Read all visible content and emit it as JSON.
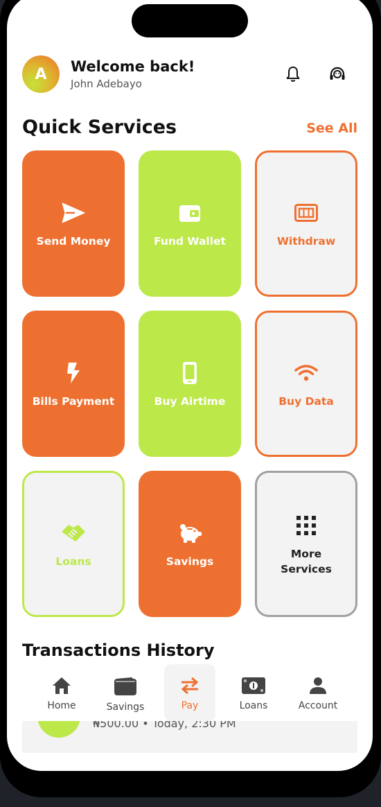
{
  "header": {
    "avatar_initial": "A",
    "welcome": "Welcome back!",
    "user_name": "John Adebayo",
    "icons": [
      "bell-icon",
      "headset-icon"
    ]
  },
  "quick_services": {
    "title": "Quick Services",
    "see_all": "See All",
    "tiles": [
      {
        "label": "Send Money",
        "icon": "send-icon",
        "style": "orange"
      },
      {
        "label": "Fund Wallet",
        "icon": "wallet-icon",
        "style": "lime"
      },
      {
        "label": "Withdraw",
        "icon": "cash-icon",
        "style": "outline-orange"
      },
      {
        "label": "Bills Payment",
        "icon": "lightning-icon",
        "style": "orange"
      },
      {
        "label": "Buy Airtime",
        "icon": "phone-icon",
        "style": "lime"
      },
      {
        "label": "Buy Data",
        "icon": "wifi-icon",
        "style": "outline-orange"
      },
      {
        "label": "Loans",
        "icon": "handshake-icon",
        "style": "outline-lime"
      },
      {
        "label": "Savings",
        "icon": "piggy-bank-icon",
        "style": "orange"
      },
      {
        "label": "More Services",
        "icon": "grid-icon",
        "style": "outline-gray"
      }
    ]
  },
  "transactions": {
    "title": "Transactions History",
    "items": [
      {
        "meta": "₦500.00 • Today, 2:30 PM"
      }
    ]
  },
  "bottom_nav": {
    "items": [
      {
        "label": "Home",
        "icon": "home-icon"
      },
      {
        "label": "Savings",
        "icon": "wallet-icon"
      },
      {
        "label": "Pay",
        "icon": "transfer-icon",
        "active": true
      },
      {
        "label": "Loans",
        "icon": "money-icon"
      },
      {
        "label": "Account",
        "icon": "user-icon"
      }
    ]
  },
  "colors": {
    "orange": "#ee7030",
    "lime": "#bde84a",
    "gray_border": "#a0a0a0",
    "tile_bg": "#f3f3f3"
  }
}
